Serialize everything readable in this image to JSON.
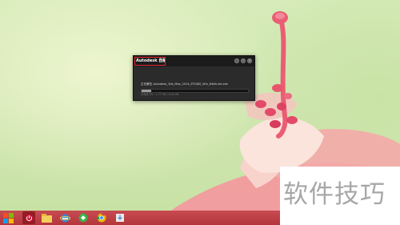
{
  "dialog": {
    "title": "Autodesk 自解压",
    "minimize_symbol": "–",
    "close_symbol": "×",
    "status": "正在解压 Autodesk_3ds_Max_2014_EFGJKS_Win_64bit.sfx.exe",
    "progress_fraction": 0.09,
    "detail": "已完成 9% · 1.77 GB / 6.04 GB"
  },
  "taskbar": {
    "buttons": [
      {
        "icon": "start-logo-icon",
        "color": "#f0a91b"
      },
      {
        "icon": "power-icon",
        "color": "#c8102e"
      },
      {
        "icon": "file-explorer-icon",
        "color": "#f2cf5b"
      },
      {
        "icon": "internet-explorer-icon",
        "color": "#2a8de0"
      },
      {
        "icon": "green-app-icon",
        "color": "#3fae49"
      },
      {
        "icon": "chrome-icon",
        "color": "#e5b800"
      },
      {
        "icon": "download-icon",
        "color": "#e9e9e9"
      }
    ]
  },
  "watermark": {
    "text": "软件技巧"
  }
}
